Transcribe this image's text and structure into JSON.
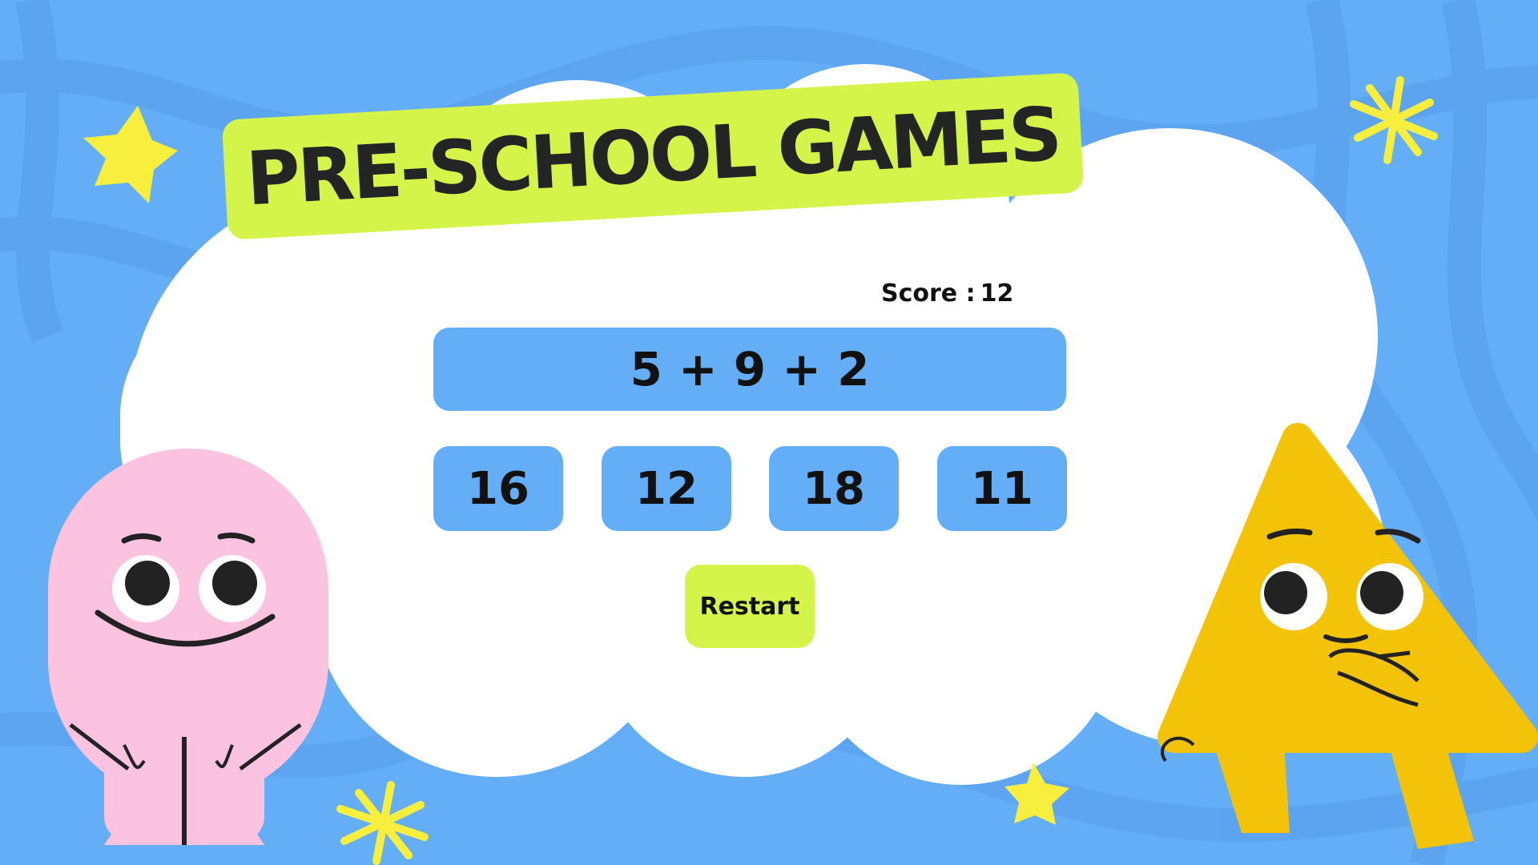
{
  "title": "PRE-SCHOOL GAMES",
  "score": {
    "label": "Score :",
    "value": "12"
  },
  "question": "5 + 9 + 2",
  "options": [
    "16",
    "12",
    "18",
    "11"
  ],
  "restart_label": "Restart",
  "colors": {
    "background": "#64aef8",
    "accent": "#d4f44a",
    "button": "#64aef8",
    "cloud": "#ffffff",
    "pink_character": "#fcc3e0",
    "yellow_character": "#f3c30a",
    "star": "#f7ee3d"
  },
  "icons": {
    "stars": [
      "star-icon",
      "sparkle-icon"
    ],
    "characters": [
      "pink-blob-character",
      "yellow-triangle-character"
    ]
  }
}
